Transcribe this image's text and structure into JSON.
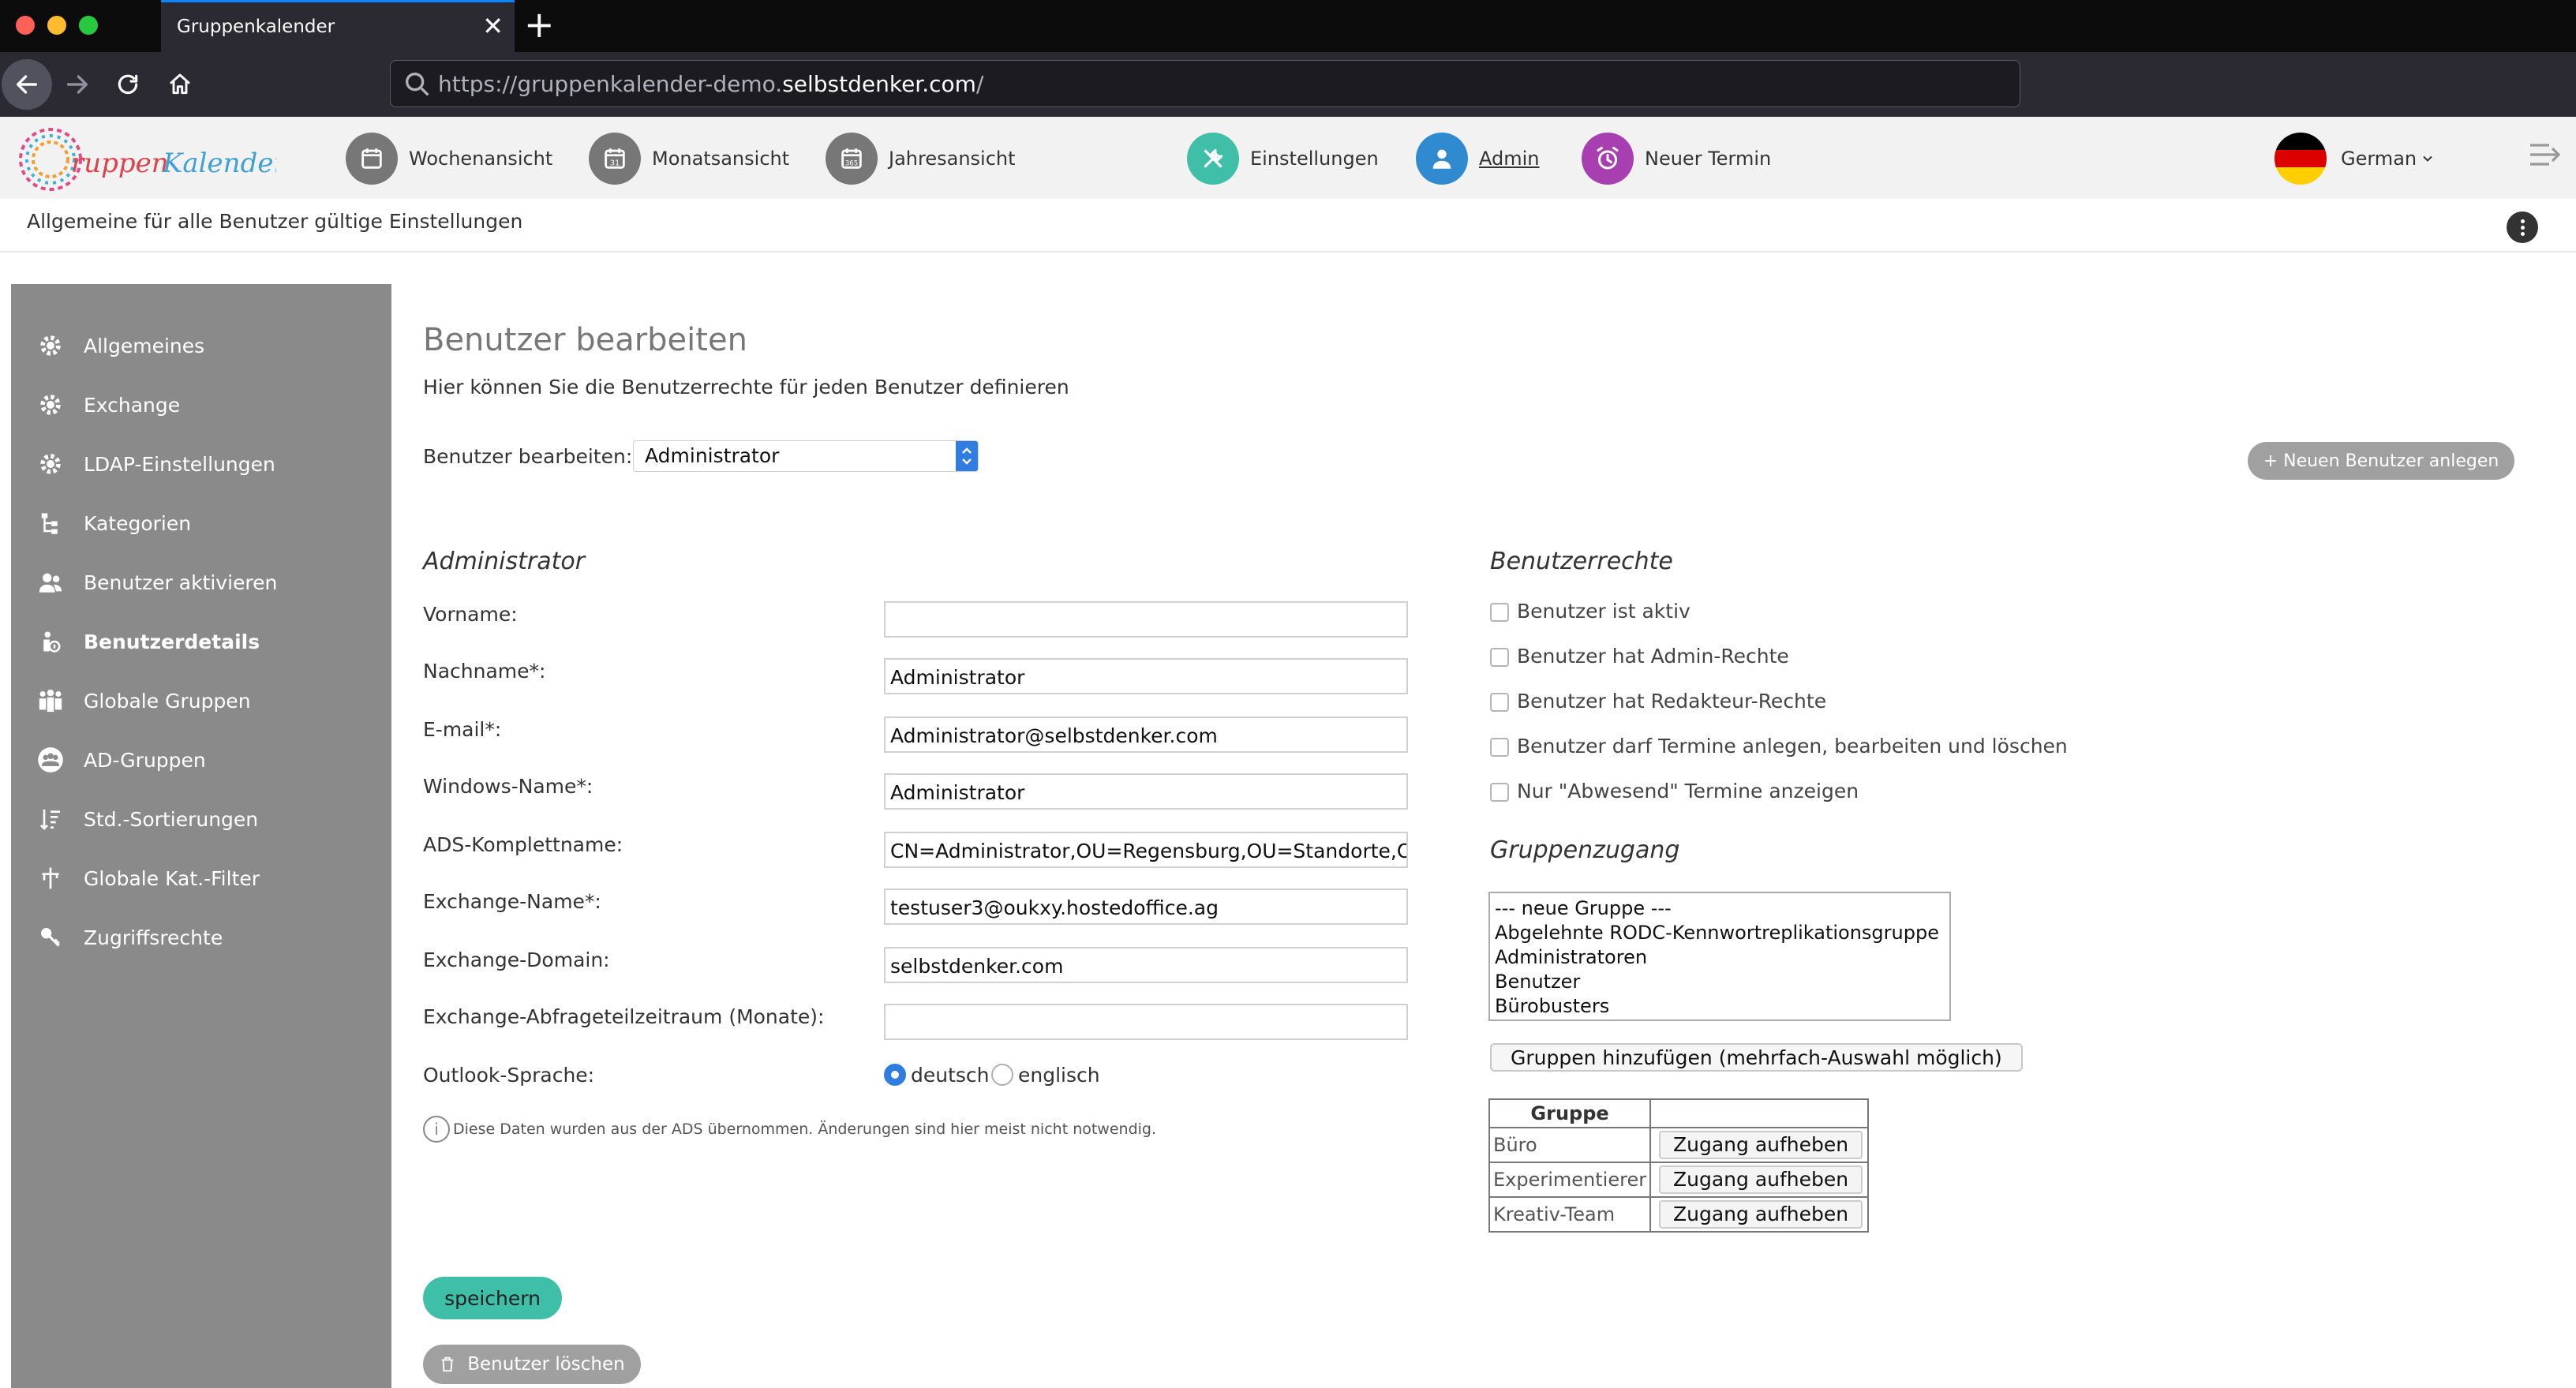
{
  "browser": {
    "tab_title": "Gruppenkalender",
    "url_prefix": "https://gruppenkalender-demo.",
    "url_domain": "selbstdenker.com",
    "url_suffix": "/"
  },
  "header": {
    "logo_text": "GruppenKalender",
    "nav": [
      {
        "label": "Wochenansicht",
        "icon": "week-calendar-icon"
      },
      {
        "label": "Monatsansicht",
        "icon": "month-calendar-icon"
      },
      {
        "label": "Jahresansicht",
        "icon": "year-calendar-icon"
      },
      {
        "label": "Einstellungen",
        "icon": "tools-icon"
      },
      {
        "label": "Admin",
        "icon": "user-icon"
      },
      {
        "label": "Neuer Termin",
        "icon": "alarm-icon"
      }
    ],
    "language": "German",
    "colors": {
      "settings": "#3fbfa8",
      "admin": "#2f8ad0",
      "new_event": "#a83fb0",
      "calendar": "#777777"
    }
  },
  "subheader": {
    "text": "Allgemeine für alle Benutzer gültige Einstellungen"
  },
  "sidebar": {
    "items": [
      {
        "label": "Allgemeines",
        "icon": "gear-icon"
      },
      {
        "label": "Exchange",
        "icon": "gear-icon"
      },
      {
        "label": "LDAP-Einstellungen",
        "icon": "gear-icon"
      },
      {
        "label": "Kategorien",
        "icon": "tree-icon"
      },
      {
        "label": "Benutzer aktivieren",
        "icon": "users-icon"
      },
      {
        "label": "Benutzerdetails",
        "icon": "user-info-icon",
        "active": true
      },
      {
        "label": "Globale Gruppen",
        "icon": "group-icon"
      },
      {
        "label": "AD-Gruppen",
        "icon": "ad-group-icon"
      },
      {
        "label": "Std.-Sortierungen",
        "icon": "sort-icon"
      },
      {
        "label": "Globale Kat.-Filter",
        "icon": "filter-icon"
      },
      {
        "label": "Zugriffsrechte",
        "icon": "key-icon"
      }
    ]
  },
  "main": {
    "title": "Benutzer bearbeiten",
    "description": "Hier können Sie die Benutzerrechte für jeden Benutzer definieren",
    "select_label": "Benutzer bearbeiten:",
    "selected_user": "Administrator",
    "new_user_button": "+ Neuen Benutzer anlegen",
    "form_title": "Administrator",
    "fields": [
      {
        "label": "Vorname:",
        "value": ""
      },
      {
        "label": "Nachname*:",
        "value": "Administrator"
      },
      {
        "label": "E-mail*:",
        "value": "Administrator@selbstdenker.com"
      },
      {
        "label": "Windows-Name*:",
        "value": "Administrator"
      },
      {
        "label": "ADS-Komplettname:",
        "value": "CN=Administrator,OU=Regensburg,OU=Standorte,OU"
      },
      {
        "label": "Exchange-Name*:",
        "value": "testuser3@oukxy.hostedoffice.ag"
      },
      {
        "label": "Exchange-Domain:",
        "value": "selbstdenker.com"
      },
      {
        "label": "Exchange-Abfrageteilzeitraum (Monate):",
        "value": ""
      }
    ],
    "outlook_label": "Outlook-Sprache:",
    "outlook_options": [
      "deutsch",
      "englisch"
    ],
    "outlook_selected": "deutsch",
    "note": "Diese Daten wurden aus der ADS übernommen. Änderungen sind hier meist nicht notwendig.",
    "save_button": "speichern",
    "delete_button": "Benutzer löschen"
  },
  "rights": {
    "title": "Benutzerrechte",
    "checkboxes": [
      {
        "label": "Benutzer ist aktiv",
        "checked": false
      },
      {
        "label": "Benutzer hat Admin-Rechte",
        "checked": false
      },
      {
        "label": "Benutzer hat Redakteur-Rechte",
        "checked": false
      },
      {
        "label": "Benutzer darf Termine anlegen, bearbeiten und löschen",
        "checked": false
      },
      {
        "label": "Nur \"Abwesend\" Termine anzeigen",
        "checked": false
      }
    ]
  },
  "group_access": {
    "title": "Gruppenzugang",
    "list": [
      "--- neue Gruppe ---",
      "Abgelehnte RODC-Kennwortreplikationsgruppe",
      "Administratoren",
      "Benutzer",
      "Bürobusters"
    ],
    "add_button": "Gruppen hinzufügen (mehrfach-Auswahl möglich)",
    "table_header": "Gruppe",
    "rows": [
      {
        "name": "Büro",
        "action": "Zugang aufheben"
      },
      {
        "name": "Experimentierer",
        "action": "Zugang aufheben"
      },
      {
        "name": "Kreativ-Team",
        "action": "Zugang aufheben"
      }
    ]
  }
}
